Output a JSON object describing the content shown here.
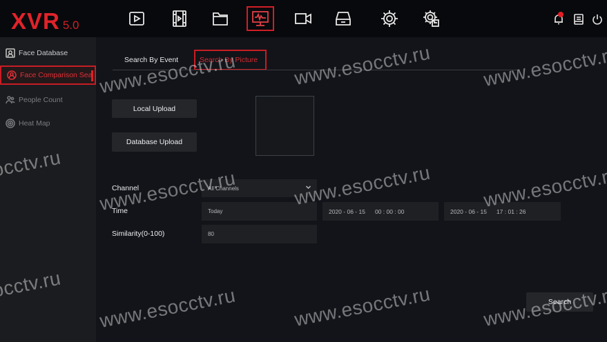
{
  "app": {
    "logo_main": "XVR",
    "logo_version": "5.0"
  },
  "topnav": [
    {
      "icon": "play-icon"
    },
    {
      "icon": "film-icon"
    },
    {
      "icon": "folder-icon"
    },
    {
      "icon": "monitor-waveform-icon",
      "active": true
    },
    {
      "icon": "camera-icon"
    },
    {
      "icon": "hdd-icon"
    },
    {
      "icon": "gear-icon"
    },
    {
      "icon": "gear-settings-icon"
    }
  ],
  "topright": [
    {
      "icon": "alarm-bell-icon",
      "badge": true
    },
    {
      "icon": "info-display-icon"
    },
    {
      "icon": "power-icon"
    }
  ],
  "sidebar": {
    "items": [
      {
        "label": "Face Database",
        "icon": "face-database-icon"
      },
      {
        "label": "Face Comparison Sea",
        "icon": "face-comparison-icon",
        "active": true
      },
      {
        "label": "People Count",
        "icon": "people-count-icon"
      },
      {
        "label": "Heat Map",
        "icon": "heat-map-icon"
      }
    ]
  },
  "tabs": {
    "by_event": "Search By Event",
    "by_picture": "Search By Picture"
  },
  "buttons": {
    "local_upload": "Local Upload",
    "database_upload": "Database Upload",
    "search": "Search"
  },
  "form": {
    "channel_label": "Channel",
    "channel_value": "All Channels",
    "time_label": "Time",
    "time_value": "Today",
    "start_date": "2020 - 06 - 15",
    "start_time": "00 : 00 : 00",
    "end_date": "2020 - 06 - 15",
    "end_time": "17 : 01 : 26",
    "similarity_label": "Similarity(0-100)",
    "similarity_value": "80"
  },
  "watermark": "www.esocctv.ru",
  "colors": {
    "accent": "#e1232a",
    "background": "#121419",
    "sidebar": "#1b1c1f"
  }
}
